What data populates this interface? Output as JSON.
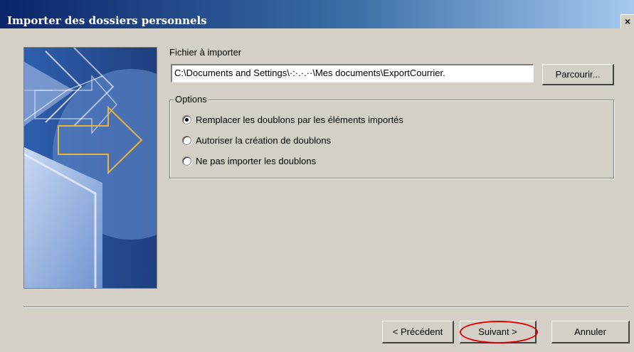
{
  "window": {
    "title": "Importer des dossiers personnels",
    "close_glyph": "×"
  },
  "file": {
    "label": "Fichier à importer",
    "value": "C:\\Documents and Settings\\·:·.·.··\\Mes documents\\ExportCourrier.",
    "browse_label": "Parcourir..."
  },
  "options": {
    "legend": "Options",
    "items": [
      {
        "label": "Remplacer les doublons par les éléments importés",
        "checked": true
      },
      {
        "label": "Autoriser la création de doublons",
        "checked": false
      },
      {
        "label": "Ne pas importer les doublons",
        "checked": false
      }
    ]
  },
  "footer": {
    "prev_label": "< Précédent",
    "next_label": "Suivant >",
    "cancel_label": "Annuler"
  },
  "colors": {
    "titlebar": "#0a246a",
    "face": "#d4d0c8",
    "highlight": "#e00000",
    "arrow": "#e8b53a"
  },
  "icons": {
    "wizard_art": "wizard-arrows-illustration",
    "radio": "radio-button-icon",
    "close": "close-icon"
  }
}
